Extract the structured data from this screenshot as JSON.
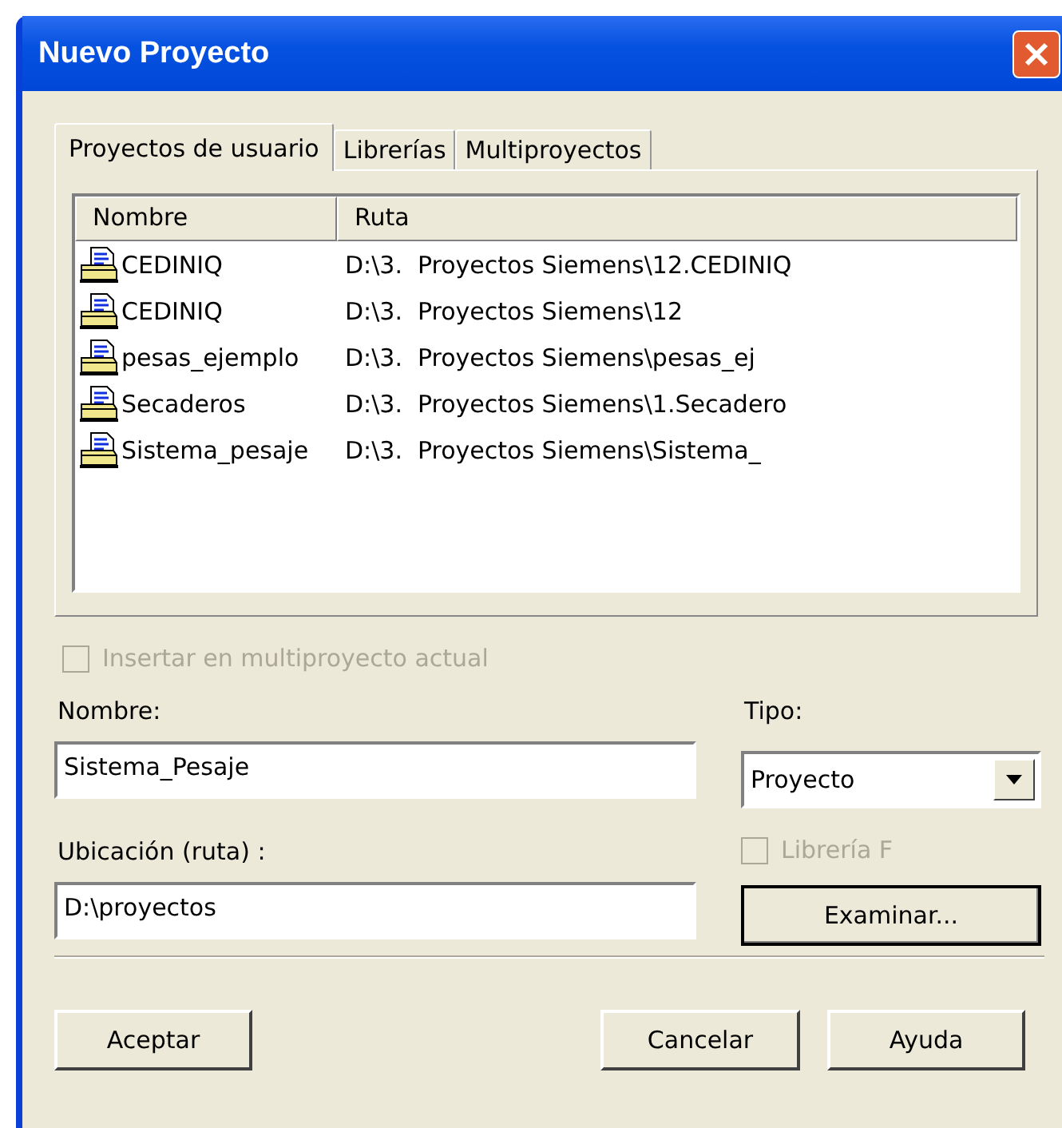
{
  "window": {
    "title": "Nuevo Proyecto"
  },
  "tabs": [
    {
      "label": "Proyectos de usuario",
      "selected": true
    },
    {
      "label": "Librerías",
      "selected": false
    },
    {
      "label": "Multiproyectos",
      "selected": false
    }
  ],
  "list": {
    "columns": [
      "Nombre",
      "Ruta"
    ],
    "rows": [
      {
        "name": "CEDINIQ",
        "path": "D:\\3.  Proyectos Siemens\\12.CEDINIQ"
      },
      {
        "name": "CEDINIQ",
        "path": "D:\\3.  Proyectos Siemens\\12"
      },
      {
        "name": "pesas_ejemplo",
        "path": "D:\\3.  Proyectos Siemens\\pesas_ej"
      },
      {
        "name": "Secaderos",
        "path": "D:\\3.  Proyectos Siemens\\1.Secadero"
      },
      {
        "name": "Sistema_pesaje",
        "path": "D:\\3.  Proyectos Siemens\\Sistema_"
      }
    ]
  },
  "insert_multiproject": {
    "label": "Insertar en multiproyecto actual",
    "checked": false,
    "disabled": true
  },
  "name_field": {
    "label": "Nombre:",
    "value": "Sistema_Pesaje"
  },
  "type_field": {
    "label": "Tipo:",
    "value": "Proyecto"
  },
  "library_f": {
    "label": "Librería F",
    "checked": false,
    "disabled": true
  },
  "location_field": {
    "label": "Ubicación (ruta) :",
    "value": "D:\\proyectos"
  },
  "browse_button": "Examinar...",
  "buttons": [
    "Aceptar",
    "Cancelar",
    "Ayuda"
  ]
}
